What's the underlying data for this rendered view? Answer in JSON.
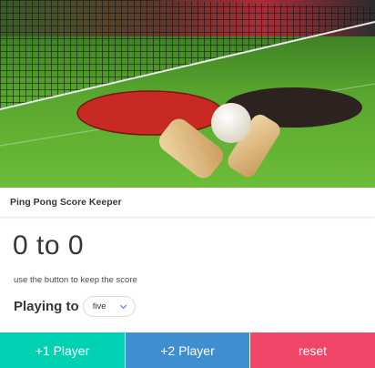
{
  "hero": {
    "image": "ping-pong-paddles-and-ball-on-table"
  },
  "card": {
    "title": "Ping Pong Score Keeper"
  },
  "score": {
    "display": "0 to 0"
  },
  "help_text": "use the button to keep the score",
  "playing_to": {
    "label": "Playing to",
    "selected": "five"
  },
  "buttons": {
    "player1": "+1 Player",
    "player2": "+2 Player",
    "reset": "reset"
  },
  "colors": {
    "player1": "#00d1b2",
    "player2": "#3e8ed0",
    "reset": "#f14668",
    "select_arrow": "#3273dc"
  }
}
